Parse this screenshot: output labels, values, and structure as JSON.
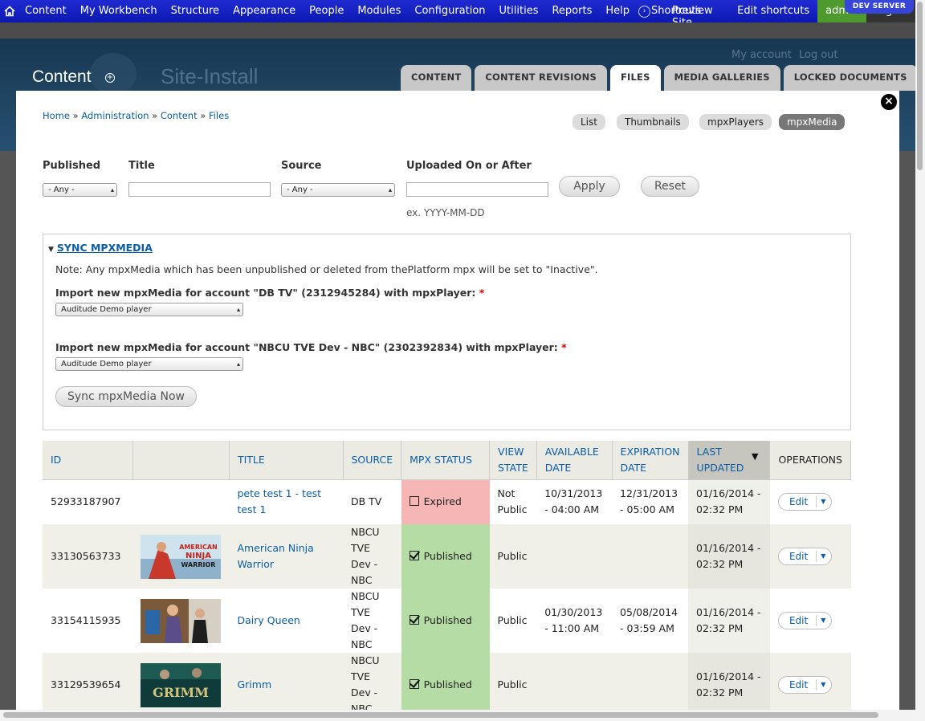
{
  "toolbar": {
    "menu": [
      "Content",
      "My Workbench",
      "Structure",
      "Appearance",
      "People",
      "Modules",
      "Configuration",
      "Utilities",
      "Reports",
      "Help"
    ],
    "shortcuts_a": "Shortcuts",
    "shortcuts_b": "Preview Site",
    "edit_shortcuts": "Edit shortcuts",
    "admin": "admin",
    "logout": "Log out",
    "server_badge": "DEV SERVER"
  },
  "header": {
    "title": "Content",
    "site_name": "Site-Install",
    "my_account": "My account",
    "log_out": "Log out",
    "tabs": [
      "CONTENT",
      "CONTENT REVISIONS",
      "FILES",
      "MEDIA GALLERIES",
      "LOCKED DOCUMENTS"
    ],
    "active_tab": "FILES"
  },
  "breadcrumb": [
    "Home",
    "Administration",
    "Content",
    "Files"
  ],
  "breadcrumb_sep": "»",
  "views": [
    "List",
    "Thumbnails",
    "mpxPlayers",
    "mpxMedia"
  ],
  "active_view": "mpxMedia",
  "filters": {
    "published_label": "Published",
    "published_value": "- Any -",
    "title_label": "Title",
    "source_label": "Source",
    "source_value": "- Any -",
    "uploaded_label": "Uploaded On or After",
    "date_hint": "ex. YYYY-MM-DD",
    "apply": "Apply",
    "reset": "Reset"
  },
  "sync": {
    "legend": "SYNC MPXMEDIA",
    "note": "Note: Any mpxMedia which has been unpublished or deleted from thePlatform mpx will be set to \"Inactive\".",
    "account1_label": "Import new mpxMedia for account \"DB TV\" (2312945284) with mpxPlayer:",
    "account1_value": "Auditude Demo player",
    "account2_label": "Import new mpxMedia for account \"NBCU TVE Dev - NBC\" (2302392834) with mpxPlayer:",
    "account2_value": "Auditude Demo player",
    "required": "*",
    "button": "Sync mpxMedia Now"
  },
  "table": {
    "headers": {
      "id": "ID",
      "thumb": "",
      "title": "TITLE",
      "source": "SOURCE",
      "mpx_status": "MPX STATUS",
      "view_state": "VIEW STATE",
      "available": "AVAILABLE DATE",
      "expiration": "EXPIRATION DATE",
      "last_updated": "LAST UPDATED",
      "operations": "OPERATIONS"
    },
    "rows": [
      {
        "id": "52933187907",
        "title": "pete test 1 - test test 1",
        "source": "DB TV",
        "status": "Expired",
        "view_state": "Not Public",
        "available": "10/31/2013 - 04:00 AM",
        "expiration": "12/31/2013 - 05:00 AM",
        "updated": "01/16/2014 - 02:32 PM",
        "op": "Edit",
        "thumb": "none"
      },
      {
        "id": "33130563733",
        "title": "American Ninja Warrior",
        "source": "NBCU TVE Dev - NBC",
        "status": "Published",
        "view_state": "Public",
        "available": "",
        "expiration": "",
        "updated": "01/16/2014 - 02:32 PM",
        "op": "Edit",
        "thumb": "ninja",
        "thumb_text": "AMERICAN NINJA WARRIOR"
      },
      {
        "id": "33154115935",
        "title": "Dairy Queen",
        "source": "NBCU TVE Dev - NBC",
        "status": "Published",
        "view_state": "Public",
        "available": "01/30/2013 - 11:00 AM",
        "expiration": "05/08/2014 - 03:59 AM",
        "updated": "01/16/2014 - 02:32 PM",
        "op": "Edit",
        "thumb": "dq"
      },
      {
        "id": "33129539654",
        "title": "Grimm",
        "source": "NBCU TVE Dev - NBC",
        "status": "Published",
        "view_state": "Public",
        "available": "",
        "expiration": "",
        "updated": "01/16/2014 - 02:32 PM",
        "op": "Edit",
        "thumb": "grimm",
        "thumb_text": "GRIMM"
      }
    ]
  },
  "close_symbol": "×"
}
